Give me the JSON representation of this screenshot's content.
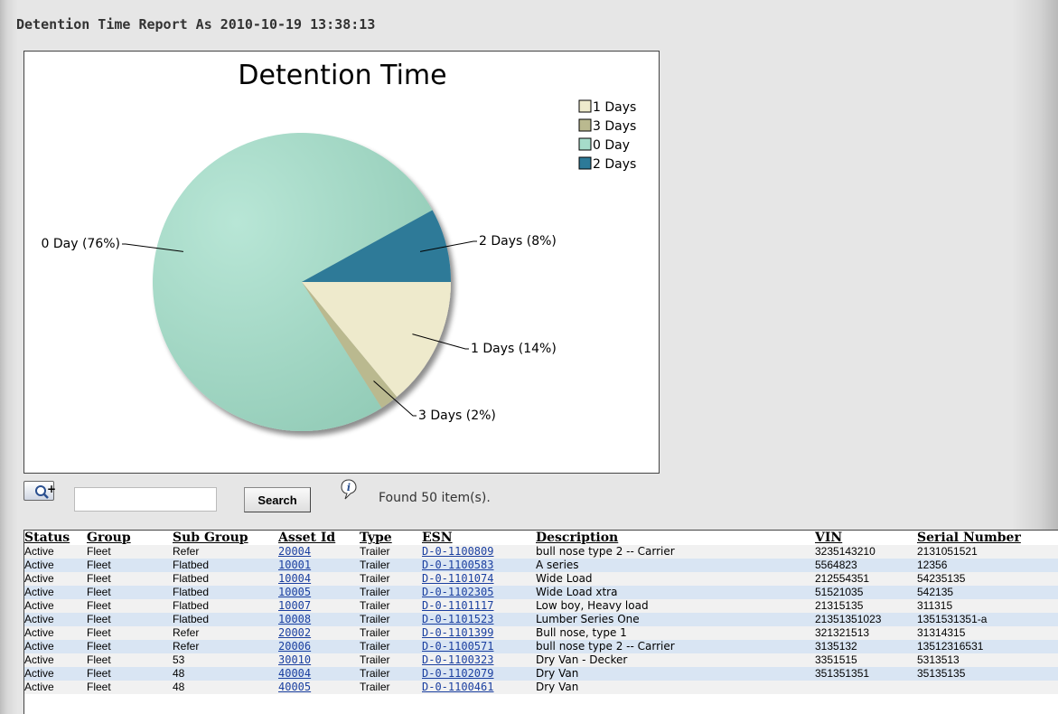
{
  "report": {
    "title": "Detention Time Report As 2010-10-19 13:38:13"
  },
  "chart_data": {
    "type": "pie",
    "title": "Detention Time",
    "slices": [
      {
        "label": "1 Days",
        "percent": 14,
        "color": "#eeeacc",
        "callout": "1 Days (14%)"
      },
      {
        "label": "3 Days",
        "percent": 2,
        "color": "#bab98f",
        "callout": "3 Days (2%)"
      },
      {
        "label": "0 Day",
        "percent": 76,
        "color": "#a6dcca",
        "callout": "0 Day (76%)"
      },
      {
        "label": "2 Days",
        "percent": 8,
        "color": "#2d7a98",
        "callout": "2 Days (8%)"
      }
    ],
    "legend_position": "top-right"
  },
  "toolbar": {
    "search_value": "",
    "search_button": "Search",
    "found_text": "Found 50 item(s)."
  },
  "table": {
    "columns": [
      "Status",
      "Group",
      "Sub Group",
      "Asset Id",
      "Type",
      "ESN",
      "Description",
      "VIN",
      "Serial Number"
    ],
    "rows": [
      [
        "Active",
        "Fleet",
        "Refer",
        "20004",
        "Trailer",
        "D-0-1100809",
        "bull nose type 2 -- Carrier",
        "3235143210",
        "2131051521"
      ],
      [
        "Active",
        "Fleet",
        "Flatbed",
        "10001",
        "Trailer",
        "D-0-1100583",
        "A series",
        "5564823",
        "12356"
      ],
      [
        "Active",
        "Fleet",
        "Flatbed",
        "10004",
        "Trailer",
        "D-0-1101074",
        "Wide Load",
        "212554351",
        "54235135"
      ],
      [
        "Active",
        "Fleet",
        "Flatbed",
        "10005",
        "Trailer",
        "D-0-1102305",
        "Wide Load xtra",
        "51521035",
        "542135"
      ],
      [
        "Active",
        "Fleet",
        "Flatbed",
        "10007",
        "Trailer",
        "D-0-1101117",
        "Low boy, Heavy load",
        "21315135",
        "311315"
      ],
      [
        "Active",
        "Fleet",
        "Flatbed",
        "10008",
        "Trailer",
        "D-0-1101523",
        "Lumber Series One",
        "21351351023",
        "1351531351-a"
      ],
      [
        "Active",
        "Fleet",
        "Refer",
        "20002",
        "Trailer",
        "D-0-1101399",
        "Bull nose, type 1",
        "321321513",
        "31314315"
      ],
      [
        "Active",
        "Fleet",
        "Refer",
        "20006",
        "Trailer",
        "D-0-1100571",
        "bull nose type 2 -- Carrier",
        "3135132",
        "13512316531"
      ],
      [
        "Active",
        "Fleet",
        "53",
        "30010",
        "Trailer",
        "D-0-1100323",
        "Dry Van - Decker",
        "3351515",
        "5313513"
      ],
      [
        "Active",
        "Fleet",
        "48",
        "40004",
        "Trailer",
        "D-0-1102079",
        "Dry Van",
        "351351351",
        "35135135"
      ],
      [
        "Active",
        "Fleet",
        "48",
        "40005",
        "Trailer",
        "D-0-1100461",
        "Dry Van",
        "",
        ""
      ]
    ]
  }
}
